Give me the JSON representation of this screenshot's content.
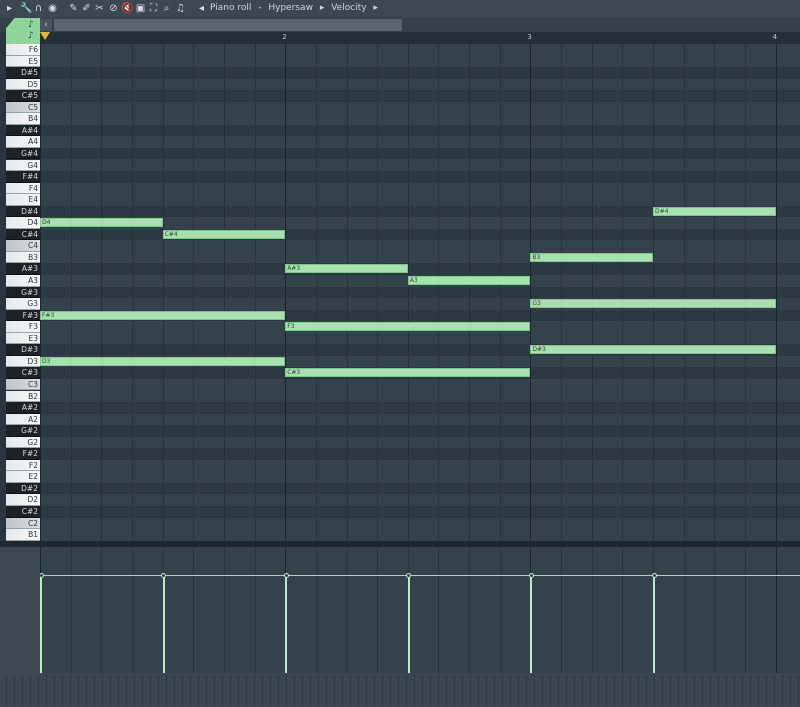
{
  "toolbar": {
    "icons": [
      "menu-arrow-icon",
      "wrench-icon",
      "magnet-icon",
      "record-icon",
      "pencil-icon",
      "brush-icon",
      "slice-icon",
      "delete-icon",
      "mute-icon",
      "select-icon",
      "zoom-fit-icon",
      "zoom-icon",
      "speaker-icon"
    ],
    "title_parts": [
      "Piano roll",
      "-",
      "Hypersaw",
      "▸",
      "Velocity",
      "▸"
    ]
  },
  "ruler": {
    "labels": [
      "2",
      "3",
      "4"
    ]
  },
  "keys": [
    "F6",
    "E5",
    "D#5",
    "D5",
    "C#5",
    "C5",
    "B4",
    "A#4",
    "A4",
    "G#4",
    "G4",
    "F#4",
    "F4",
    "E4",
    "D#4",
    "D4",
    "C#4",
    "C4",
    "B3",
    "A#3",
    "A3",
    "G#3",
    "G3",
    "F#3",
    "F3",
    "E3",
    "D#3",
    "D3",
    "C#3",
    "C3",
    "B2",
    "A#2",
    "A2",
    "G#2",
    "G2",
    "F#2",
    "F2",
    "E2",
    "D#2",
    "D2",
    "C#2",
    "C2",
    "B1"
  ],
  "notes": [
    {
      "label": "D4",
      "pitch": "D4",
      "start": 0,
      "length": 2
    },
    {
      "label": "C#4",
      "pitch": "C#4",
      "start": 2,
      "length": 2
    },
    {
      "label": "F#3",
      "pitch": "F#3",
      "start": 0,
      "length": 4
    },
    {
      "label": "D3",
      "pitch": "D3",
      "start": 0,
      "length": 4
    },
    {
      "label": "A#3",
      "pitch": "A#3",
      "start": 4,
      "length": 2
    },
    {
      "label": "A3",
      "pitch": "A3",
      "start": 6,
      "length": 2
    },
    {
      "label": "F3",
      "pitch": "F3",
      "start": 4,
      "length": 4
    },
    {
      "label": "C#3",
      "pitch": "C#3",
      "start": 4,
      "length": 4
    },
    {
      "label": "B3",
      "pitch": "B3",
      "start": 8,
      "length": 2
    },
    {
      "label": "D#4",
      "pitch": "D#4",
      "start": 10,
      "length": 2
    },
    {
      "label": "G3",
      "pitch": "G3",
      "start": 8,
      "length": 4
    },
    {
      "label": "D#3",
      "pitch": "D#3",
      "start": 8,
      "length": 4
    }
  ],
  "velocity": {
    "level": 0.78,
    "events": [
      0,
      2,
      4,
      6,
      8,
      10
    ]
  }
}
